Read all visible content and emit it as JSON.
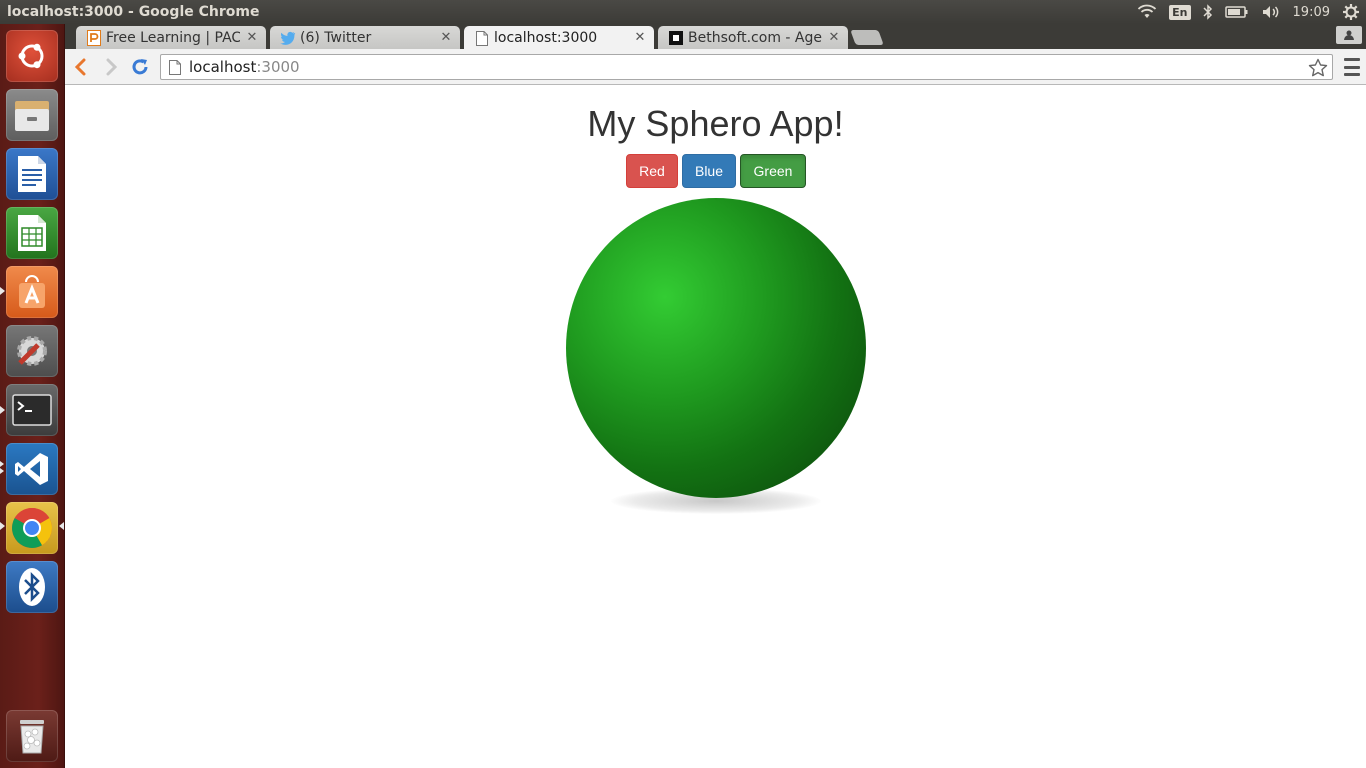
{
  "panel": {
    "window_title": "localhost:3000 - Google Chrome",
    "keyboard_layout": "En",
    "clock": "19:09",
    "icons": [
      "wifi-icon",
      "keyboard-layout-indicator",
      "bluetooth-icon",
      "battery-icon",
      "volume-icon",
      "session-gear-icon"
    ]
  },
  "launcher": {
    "items": [
      {
        "name": "ubuntu-dash",
        "icon": "ubuntu-logo-icon"
      },
      {
        "name": "files",
        "icon": "file-cabinet-icon"
      },
      {
        "name": "libreoffice-writer",
        "icon": "writer-document-icon"
      },
      {
        "name": "libreoffice-calc",
        "icon": "calc-spreadsheet-icon"
      },
      {
        "name": "ubuntu-software-center",
        "icon": "software-bag-icon"
      },
      {
        "name": "system-settings",
        "icon": "settings-wrench-icon"
      },
      {
        "name": "terminal",
        "icon": "terminal-icon"
      },
      {
        "name": "visual-studio-code",
        "icon": "vscode-icon"
      },
      {
        "name": "google-chrome",
        "icon": "chrome-icon"
      },
      {
        "name": "bluetooth",
        "icon": "bluetooth-icon"
      },
      {
        "name": "trash",
        "icon": "trash-icon"
      }
    ]
  },
  "tabs": [
    {
      "title": "Free Learning | PACKT",
      "icon": "packt-favicon",
      "active": false
    },
    {
      "title": "(6) Twitter",
      "icon": "twitter-favicon",
      "active": false
    },
    {
      "title": "localhost:3000",
      "icon": "page-favicon",
      "active": true
    },
    {
      "title": "Bethsoft.com - Age of",
      "icon": "bethsoft-favicon",
      "active": false
    }
  ],
  "toolbar": {
    "url_host": "localhost",
    "url_port": ":3000"
  },
  "page": {
    "title": "My Sphero App!",
    "buttons": [
      {
        "label": "Red",
        "color": "#d9534f"
      },
      {
        "label": "Blue",
        "color": "#337ab7"
      },
      {
        "label": "Green",
        "color": "#449d44",
        "pressed": true
      }
    ],
    "sphere": {
      "color": "green",
      "highlight": "#33cc33",
      "shadow": "#0a3f0a"
    }
  }
}
